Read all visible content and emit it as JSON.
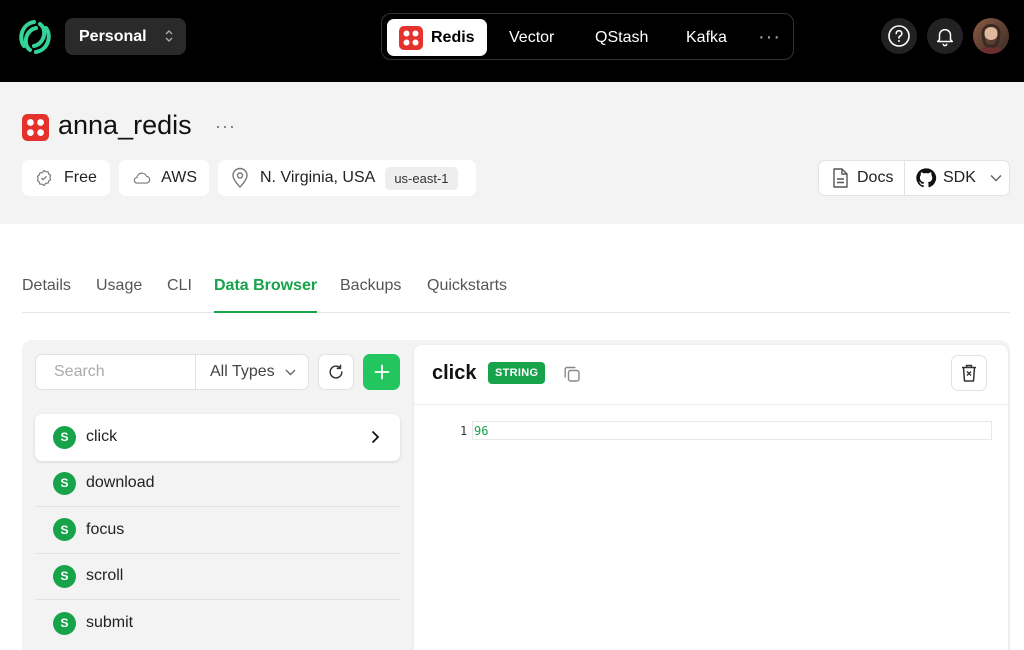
{
  "topbar": {
    "team": "Personal",
    "products": [
      "Redis",
      "Vector",
      "QStash",
      "Kafka"
    ],
    "more": "···"
  },
  "database": {
    "name": "anna_redis",
    "more": "···",
    "plan": "Free",
    "cloud": "AWS",
    "region": "N. Virginia, USA",
    "region_code": "us-east-1",
    "docs_label": "Docs",
    "sdk_label": "SDK"
  },
  "tabs": [
    "Details",
    "Usage",
    "CLI",
    "Data Browser",
    "Backups",
    "Quickstarts"
  ],
  "active_tab": "Data Browser",
  "browser": {
    "search_placeholder": "Search",
    "type_filter": "All Types",
    "keys": [
      {
        "type": "S",
        "name": "click"
      },
      {
        "type": "S",
        "name": "download"
      },
      {
        "type": "S",
        "name": "focus"
      },
      {
        "type": "S",
        "name": "scroll"
      },
      {
        "type": "S",
        "name": "submit"
      }
    ],
    "selected": {
      "name": "click",
      "type_badge": "STRING",
      "line_number": "1",
      "value": "96"
    }
  },
  "colors": {
    "accent": "#16a34a",
    "add_button": "#22c55e",
    "redis_red": "#e5322d"
  }
}
